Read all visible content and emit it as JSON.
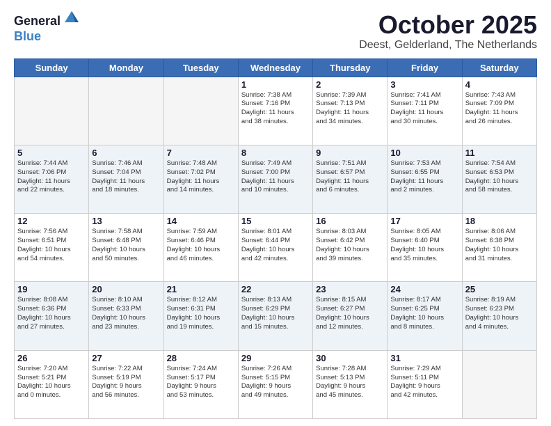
{
  "header": {
    "logo_general": "General",
    "logo_blue": "Blue",
    "month": "October 2025",
    "location": "Deest, Gelderland, The Netherlands"
  },
  "days_of_week": [
    "Sunday",
    "Monday",
    "Tuesday",
    "Wednesday",
    "Thursday",
    "Friday",
    "Saturday"
  ],
  "weeks": [
    [
      {
        "day": "",
        "info": ""
      },
      {
        "day": "",
        "info": ""
      },
      {
        "day": "",
        "info": ""
      },
      {
        "day": "1",
        "info": "Sunrise: 7:38 AM\nSunset: 7:16 PM\nDaylight: 11 hours\nand 38 minutes."
      },
      {
        "day": "2",
        "info": "Sunrise: 7:39 AM\nSunset: 7:13 PM\nDaylight: 11 hours\nand 34 minutes."
      },
      {
        "day": "3",
        "info": "Sunrise: 7:41 AM\nSunset: 7:11 PM\nDaylight: 11 hours\nand 30 minutes."
      },
      {
        "day": "4",
        "info": "Sunrise: 7:43 AM\nSunset: 7:09 PM\nDaylight: 11 hours\nand 26 minutes."
      }
    ],
    [
      {
        "day": "5",
        "info": "Sunrise: 7:44 AM\nSunset: 7:06 PM\nDaylight: 11 hours\nand 22 minutes."
      },
      {
        "day": "6",
        "info": "Sunrise: 7:46 AM\nSunset: 7:04 PM\nDaylight: 11 hours\nand 18 minutes."
      },
      {
        "day": "7",
        "info": "Sunrise: 7:48 AM\nSunset: 7:02 PM\nDaylight: 11 hours\nand 14 minutes."
      },
      {
        "day": "8",
        "info": "Sunrise: 7:49 AM\nSunset: 7:00 PM\nDaylight: 11 hours\nand 10 minutes."
      },
      {
        "day": "9",
        "info": "Sunrise: 7:51 AM\nSunset: 6:57 PM\nDaylight: 11 hours\nand 6 minutes."
      },
      {
        "day": "10",
        "info": "Sunrise: 7:53 AM\nSunset: 6:55 PM\nDaylight: 11 hours\nand 2 minutes."
      },
      {
        "day": "11",
        "info": "Sunrise: 7:54 AM\nSunset: 6:53 PM\nDaylight: 10 hours\nand 58 minutes."
      }
    ],
    [
      {
        "day": "12",
        "info": "Sunrise: 7:56 AM\nSunset: 6:51 PM\nDaylight: 10 hours\nand 54 minutes."
      },
      {
        "day": "13",
        "info": "Sunrise: 7:58 AM\nSunset: 6:48 PM\nDaylight: 10 hours\nand 50 minutes."
      },
      {
        "day": "14",
        "info": "Sunrise: 7:59 AM\nSunset: 6:46 PM\nDaylight: 10 hours\nand 46 minutes."
      },
      {
        "day": "15",
        "info": "Sunrise: 8:01 AM\nSunset: 6:44 PM\nDaylight: 10 hours\nand 42 minutes."
      },
      {
        "day": "16",
        "info": "Sunrise: 8:03 AM\nSunset: 6:42 PM\nDaylight: 10 hours\nand 39 minutes."
      },
      {
        "day": "17",
        "info": "Sunrise: 8:05 AM\nSunset: 6:40 PM\nDaylight: 10 hours\nand 35 minutes."
      },
      {
        "day": "18",
        "info": "Sunrise: 8:06 AM\nSunset: 6:38 PM\nDaylight: 10 hours\nand 31 minutes."
      }
    ],
    [
      {
        "day": "19",
        "info": "Sunrise: 8:08 AM\nSunset: 6:36 PM\nDaylight: 10 hours\nand 27 minutes."
      },
      {
        "day": "20",
        "info": "Sunrise: 8:10 AM\nSunset: 6:33 PM\nDaylight: 10 hours\nand 23 minutes."
      },
      {
        "day": "21",
        "info": "Sunrise: 8:12 AM\nSunset: 6:31 PM\nDaylight: 10 hours\nand 19 minutes."
      },
      {
        "day": "22",
        "info": "Sunrise: 8:13 AM\nSunset: 6:29 PM\nDaylight: 10 hours\nand 15 minutes."
      },
      {
        "day": "23",
        "info": "Sunrise: 8:15 AM\nSunset: 6:27 PM\nDaylight: 10 hours\nand 12 minutes."
      },
      {
        "day": "24",
        "info": "Sunrise: 8:17 AM\nSunset: 6:25 PM\nDaylight: 10 hours\nand 8 minutes."
      },
      {
        "day": "25",
        "info": "Sunrise: 8:19 AM\nSunset: 6:23 PM\nDaylight: 10 hours\nand 4 minutes."
      }
    ],
    [
      {
        "day": "26",
        "info": "Sunrise: 7:20 AM\nSunset: 5:21 PM\nDaylight: 10 hours\nand 0 minutes."
      },
      {
        "day": "27",
        "info": "Sunrise: 7:22 AM\nSunset: 5:19 PM\nDaylight: 9 hours\nand 56 minutes."
      },
      {
        "day": "28",
        "info": "Sunrise: 7:24 AM\nSunset: 5:17 PM\nDaylight: 9 hours\nand 53 minutes."
      },
      {
        "day": "29",
        "info": "Sunrise: 7:26 AM\nSunset: 5:15 PM\nDaylight: 9 hours\nand 49 minutes."
      },
      {
        "day": "30",
        "info": "Sunrise: 7:28 AM\nSunset: 5:13 PM\nDaylight: 9 hours\nand 45 minutes."
      },
      {
        "day": "31",
        "info": "Sunrise: 7:29 AM\nSunset: 5:11 PM\nDaylight: 9 hours\nand 42 minutes."
      },
      {
        "day": "",
        "info": ""
      }
    ]
  ]
}
